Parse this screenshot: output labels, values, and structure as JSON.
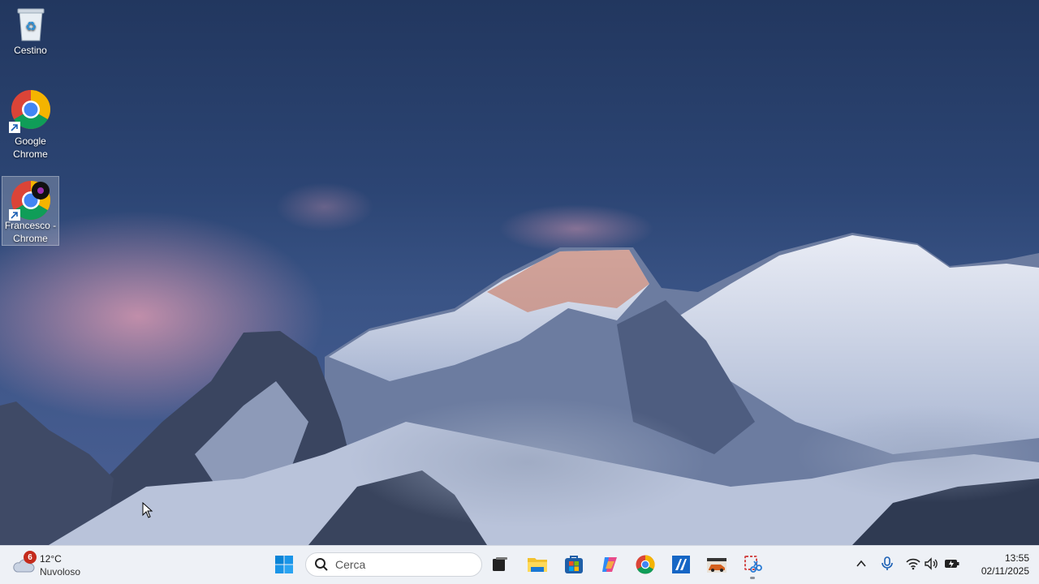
{
  "desktop": {
    "icons": [
      {
        "label": "Cestino",
        "icon": "recycle-bin-icon"
      },
      {
        "label": "Google Chrome",
        "icon": "chrome-icon",
        "shortcut": true
      },
      {
        "label": "Francesco - Chrome",
        "icon": "chrome-profile-icon",
        "shortcut": true,
        "selected": true
      }
    ]
  },
  "taskbar": {
    "weather": {
      "temp": "12°C",
      "condition": "Nuvoloso",
      "badge": "6"
    },
    "search": {
      "placeholder": "Cerca"
    },
    "apps": [
      {
        "name": "start-button",
        "icon": "windows-logo-icon"
      },
      {
        "name": "task-view-button",
        "icon": "task-view-icon"
      },
      {
        "name": "file-explorer-button",
        "icon": "folder-icon"
      },
      {
        "name": "microsoft-store-button",
        "icon": "store-icon"
      },
      {
        "name": "copilot-button",
        "icon": "copilot-icon"
      },
      {
        "name": "chrome-button",
        "icon": "chrome-icon"
      },
      {
        "name": "app-button",
        "icon": "blue-app-icon"
      },
      {
        "name": "game-app-button",
        "icon": "car-game-icon"
      },
      {
        "name": "snipping-tool-button",
        "icon": "snipping-tool-icon",
        "running": true
      }
    ],
    "tray": [
      "chevron-up-icon",
      "microphone-icon",
      "wifi-icon",
      "volume-icon",
      "battery-icon"
    ],
    "clock": {
      "time": "13:55",
      "date": "02/11/2025"
    }
  },
  "colors": {
    "sky": "#2c4574",
    "taskbar": "#eef1f6",
    "badge": "#c42b1c",
    "accent": "#0078d4"
  }
}
